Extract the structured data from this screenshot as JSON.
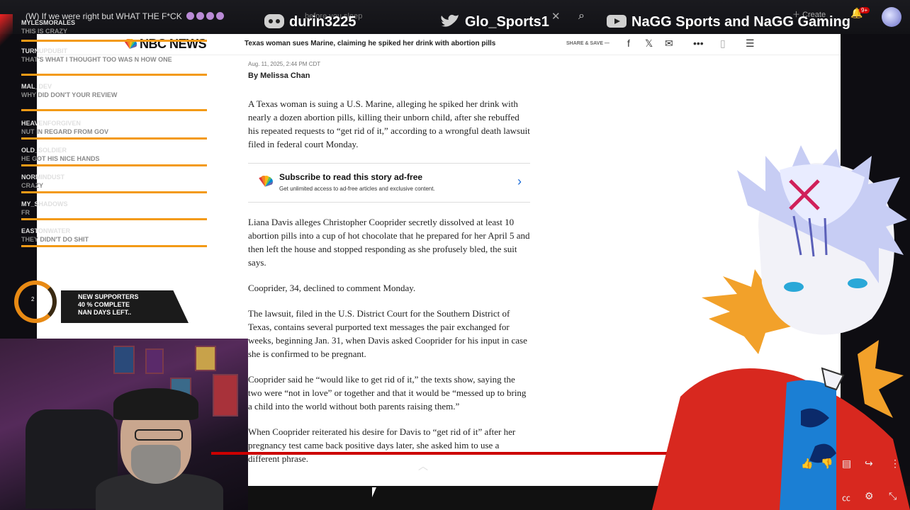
{
  "overlay": {
    "stream_title": "(W) If we were right but WHAT THE F*CK",
    "tooltip_hint": "before you sleep",
    "socials": {
      "discord": "durin3225",
      "twitter": "Glo_Sports1",
      "youtube": "NaGG Sports and NaGG Gaming"
    },
    "youtube_create": "Create",
    "youtube_notif_badge": "9+",
    "chat": [
      {
        "name": "MYLESMORALES",
        "text": "THIS IS CRAZY"
      },
      {
        "name": "TURNUPDUBIT",
        "text": "THAT'S WHAT I THOUGHT TOO WAS N HOW ONE"
      },
      {
        "name": "MAL_DEV",
        "text": "WHY DID DON'T YOUR REVIEW"
      },
      {
        "name": "HEAVENFORGIVEN",
        "text": "NUT IN REGARD FROM GOV"
      },
      {
        "name": "OLD_SOLDIER",
        "text": "HE GOT HIS NICE HANDS"
      },
      {
        "name": "NORMINDUST",
        "text": "CRAZY"
      },
      {
        "name": "MY_SHADOWS",
        "text": "FR"
      },
      {
        "name": "EASTONWATER",
        "text": "THEY DIDN'T DO SHIT"
      }
    ],
    "supporters": {
      "line1": "NEW SUPPORTERS",
      "line2": "40 % COMPLETE",
      "line3": "NAN DAYS LEFT..",
      "ring_value": "2"
    }
  },
  "nbc": {
    "logo": "NBC NEWS",
    "headline": "Texas woman sues Marine, claiming he spiked her drink with abortion pills",
    "share_label": "SHARE & SAVE —",
    "share_icons": [
      "facebook-icon",
      "x-icon",
      "mail-icon",
      "more-icon",
      "bookmark-icon",
      "menu-icon"
    ]
  },
  "article": {
    "date": "Aug. 11, 2025, 2:44 PM CDT",
    "byline": "By Melissa Chan",
    "paragraphs": [
      "A Texas woman is suing a U.S. Marine, alleging he spiked her drink with nearly a dozen abortion pills, killing their unborn child, after she rebuffed his repeated requests to “get rid of it,” according to a wrongful death lawsuit filed in federal court Monday.",
      "Liana Davis alleges Christopher Cooprider secretly dissolved at least 10 abortion pills into a cup of hot chocolate that he prepared for her April 5 and then left the house and stopped responding as she profusely bled, the suit says.",
      "Cooprider, 34, declined to comment Monday.",
      "The lawsuit, filed in the U.S. District Court for the Southern District of Texas, contains several purported text messages the pair exchanged for weeks, beginning Jan. 31, when Davis asked Cooprider for his input in case she is confirmed to be pregnant.",
      "Cooprider said he “would like to get rid of it,” the texts show, saying the two were “not in love” or together and that it would be “messed up to bring a child into the world without both parents raising them.”",
      "When Cooprider reiterated his desire for Davis to “get rid of it” after her pregnancy test came back positive days later, she asked him to use a different phrase."
    ],
    "subscribe_title": "Subscribe to read this story ad-free",
    "subscribe_text": "Get unlimited access to ad-free articles and exclusive content."
  },
  "colors": {
    "accent_orange": "#f39a16",
    "nbc_link": "#1a6bd8",
    "jacket_red": "#d8281f"
  }
}
